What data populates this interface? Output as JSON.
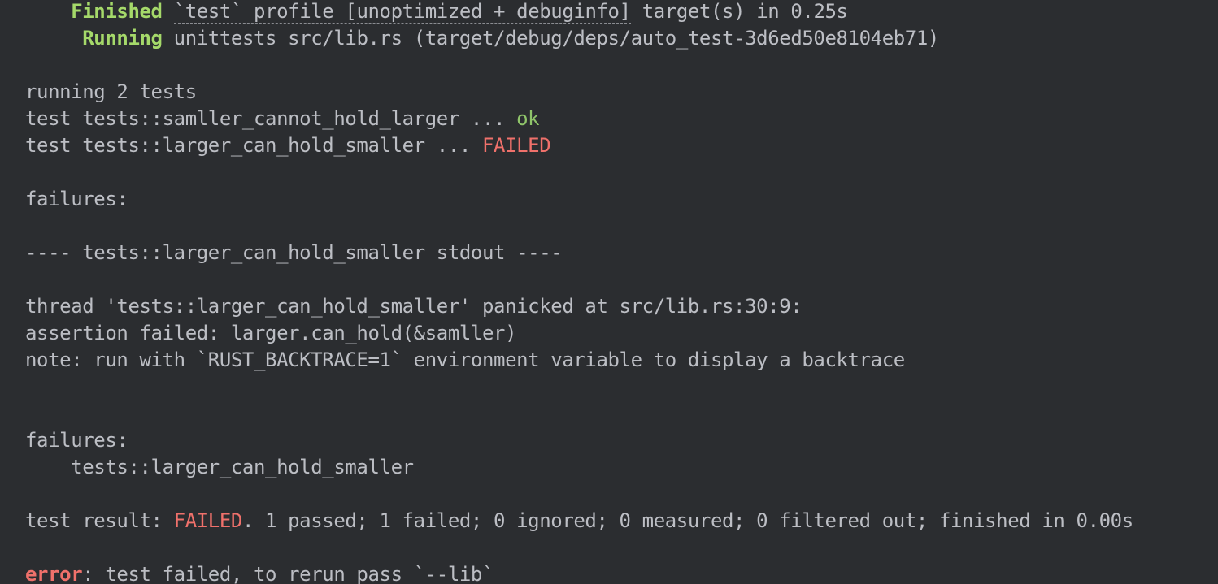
{
  "terminal": {
    "line1": {
      "indent": "    ",
      "status": "Finished",
      "profile_link": "`test` profile [unoptimized + debuginfo]",
      "rest": " target(s) in 0.25s"
    },
    "line2": {
      "indent": "     ",
      "status": "Running",
      "rest": " unittests src/lib.rs (target/debug/deps/auto_test-3d6ed50e8104eb71)"
    },
    "running": "running 2 tests",
    "test1": {
      "prefix": "test tests::samller_cannot_hold_larger ... ",
      "result": "ok"
    },
    "test2": {
      "prefix": "test tests::larger_can_hold_smaller ... ",
      "result": "FAILED"
    },
    "failures_header_1": "failures:",
    "stdout_header": "---- tests::larger_can_hold_smaller stdout ----",
    "panic_line": "thread 'tests::larger_can_hold_smaller' panicked at src/lib.rs:30:9:",
    "assertion_line": "assertion failed: larger.can_hold(&samller)",
    "note_line": "note: run with `RUST_BACKTRACE=1` environment variable to display a backtrace",
    "failures_header_2": "failures:",
    "failed_test_name": "    tests::larger_can_hold_smaller",
    "result": {
      "label": "test result: ",
      "status": "FAILED",
      "summary": ". 1 passed; 1 failed; 0 ignored; 0 measured; 0 filtered out; finished in 0.00s"
    },
    "error": {
      "label": "error",
      "message": ": test failed, to rerun pass `--lib`"
    }
  },
  "colors": {
    "background": "#2b2d30",
    "text": "#bcbec4",
    "success": "#8fc46a",
    "failure": "#f0716b"
  }
}
